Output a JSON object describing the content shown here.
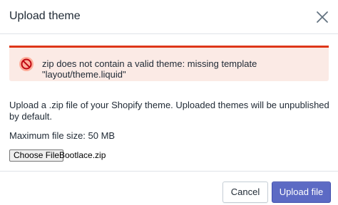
{
  "modal": {
    "title": "Upload theme",
    "close_icon": "close-icon"
  },
  "error_banner": {
    "icon": "error-icon",
    "line1": "zip does not contain a valid theme: missing template",
    "line2": "\"layout/theme.liquid\"",
    "border_color": "#de3618",
    "background_color": "#fbeae5"
  },
  "description": "Upload a .zip file of your Shopify theme. Uploaded themes will be unpublished by default.",
  "max_size": "Maximum file size: 50 MB",
  "file_input": {
    "button_label": "Choose File",
    "selected_file": "Bootlace.zip"
  },
  "footer": {
    "cancel_label": "Cancel",
    "upload_label": "Upload file",
    "primary_color": "#5c6ac4"
  }
}
